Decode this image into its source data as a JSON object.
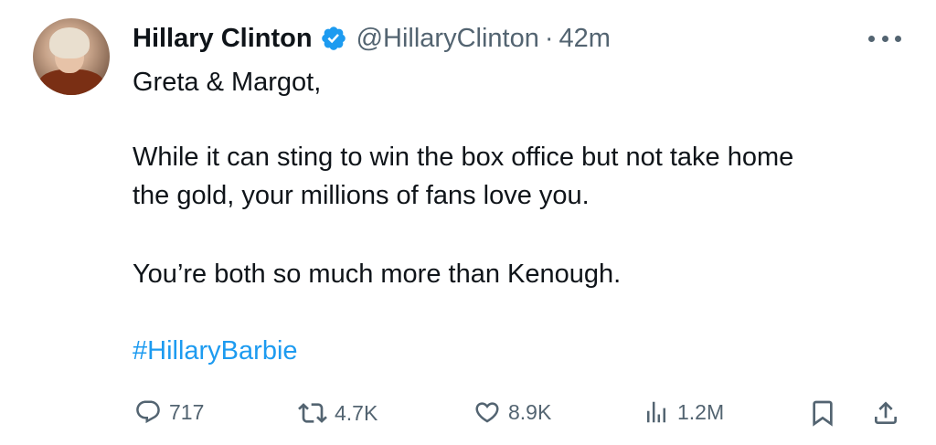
{
  "tweet": {
    "author_name": "Hillary Clinton",
    "handle": "@HillaryClinton",
    "separator": "·",
    "time": "42m",
    "lines": [
      "Greta & Margot,",
      "While it can sting to win the box office but not take home",
      "the gold, your millions of fans love you.",
      "You’re both so much more than Kenough."
    ],
    "hashtag": "#HillaryBarbie"
  },
  "actions": {
    "replies": "717",
    "reposts": "4.7K",
    "likes": "8.9K",
    "views": "1.2M"
  },
  "colors": {
    "text": "#0f1419",
    "muted": "#536471",
    "accent": "#1d9bf0"
  },
  "icons": [
    "verified-badge-icon",
    "more-options-icon",
    "reply-icon",
    "repost-icon",
    "like-icon",
    "views-icon",
    "bookmark-icon",
    "share-icon"
  ]
}
